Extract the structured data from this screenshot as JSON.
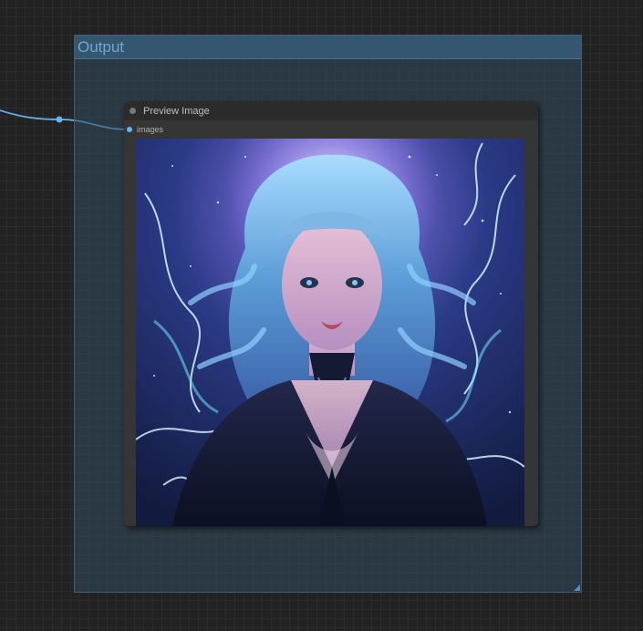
{
  "group": {
    "title": "Output"
  },
  "node": {
    "title": "Preview Image",
    "input_slot": {
      "label": "images",
      "color": "#64b5f6"
    }
  },
  "colors": {
    "canvas_bg": "#222222",
    "group_bg": "#324a5e",
    "group_title": "#6ea7d2",
    "node_bg": "#353535",
    "wire": "#64b5f6"
  }
}
